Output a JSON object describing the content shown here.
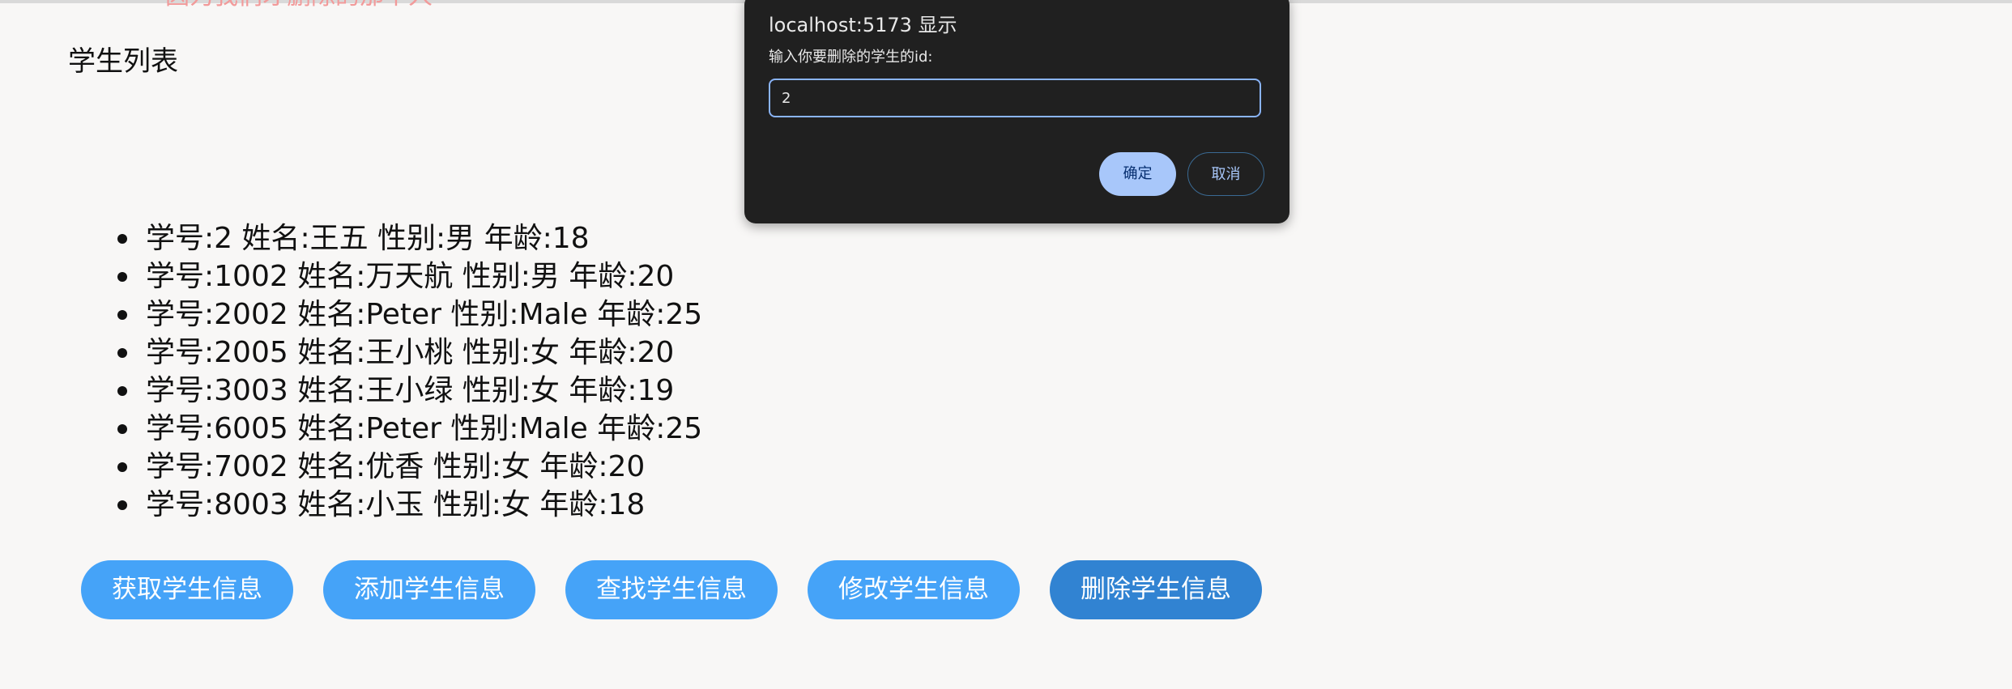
{
  "page": {
    "cut_text": "因为我们才删除的那个人",
    "title": "学生列表"
  },
  "students": [
    "学号:2 姓名:王五 性别:男 年龄:18",
    "学号:1002 姓名:万天航 性别:男 年龄:20",
    "学号:2002 姓名:Peter 性别:Male 年龄:25",
    "学号:2005 姓名:王小桃 性别:女 年龄:20",
    "学号:3003 姓名:王小绿 性别:女 年龄:19",
    "学号:6005 姓名:Peter 性别:Male 年龄:25",
    "学号:7002 姓名:优香 性别:女 年龄:20",
    "学号:8003 姓名:小玉 性别:女 年龄:18"
  ],
  "buttons": {
    "get": "获取学生信息",
    "add": "添加学生信息",
    "find": "查找学生信息",
    "edit": "修改学生信息",
    "delete": "删除学生信息"
  },
  "dialog": {
    "title": "localhost:5173 显示",
    "message": "输入你要删除的学生的id:",
    "input_value": "2",
    "confirm_label": "确定",
    "cancel_label": "取消"
  },
  "colors": {
    "button_blue": "#45a3f8",
    "button_active_blue": "#3183d2",
    "dialog_background": "#202020",
    "dialog_accent": "#a8c7fa"
  }
}
